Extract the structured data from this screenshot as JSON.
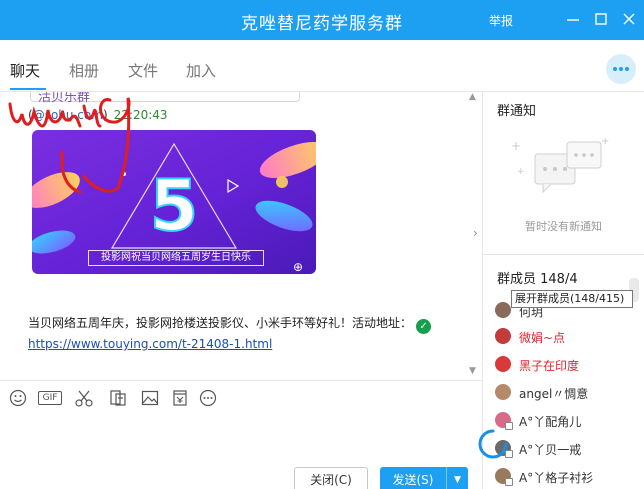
{
  "window": {
    "title": "克唑替尼药学服务群",
    "report_label": "举报",
    "accent_color": "#1ea0f2"
  },
  "tabs": [
    {
      "label": "聊天",
      "active": true
    },
    {
      "label": "相册",
      "active": false
    },
    {
      "label": "文件",
      "active": false
    },
    {
      "label": "加入",
      "active": false
    }
  ],
  "chat": {
    "quote_text": "活贝乐群",
    "sender_prefix": "(",
    "sender_email": "@sohu.com",
    "sender_suffix": ")",
    "sender_time": "22:20:43",
    "banner": {
      "big_number": "5",
      "caption": "投影网祝当贝网络五周岁生日快乐"
    },
    "message_text": "当贝网络五周年庆，投影网抢楼送投影仪、小米手环等好礼！活动地址：",
    "message_link": "https://www.touying.com/t-21408-1.html"
  },
  "toolbar": {
    "tools": [
      "emoji-icon",
      "gif-icon",
      "scissors-icon",
      "font-icon",
      "image-icon",
      "file-icon",
      "more-icon"
    ],
    "gif_label": "GIF"
  },
  "buttons": {
    "close_label": "关闭(C)",
    "send_label": "发送(S)"
  },
  "right_panel": {
    "notice_title": "群通知",
    "notice_empty": "暂时没有新通知",
    "members_title": "群成员 148/4",
    "tooltip": "展开群成员(148/415)",
    "members": [
      {
        "name": "何玥",
        "color": "#333333",
        "avatar_color": "#8a6a5a"
      },
      {
        "name": "微娟~点",
        "color": "#e0262c",
        "avatar_color": "#c33b3b"
      },
      {
        "name": "黑子在印度",
        "color": "#e0262c",
        "avatar_color": "#d83a3a"
      },
      {
        "name": "angel〃惆意",
        "color": "#333333",
        "avatar_color": "#b58a6a"
      },
      {
        "name": "A°丫配角儿",
        "color": "#333333",
        "avatar_color": "#d86a8a"
      },
      {
        "name": "A°丫贝一戒",
        "color": "#333333",
        "avatar_color": "#6a6a6a"
      },
      {
        "name": "A°丫格子衬衫",
        "color": "#333333",
        "avatar_color": "#9a7a5a"
      }
    ]
  }
}
